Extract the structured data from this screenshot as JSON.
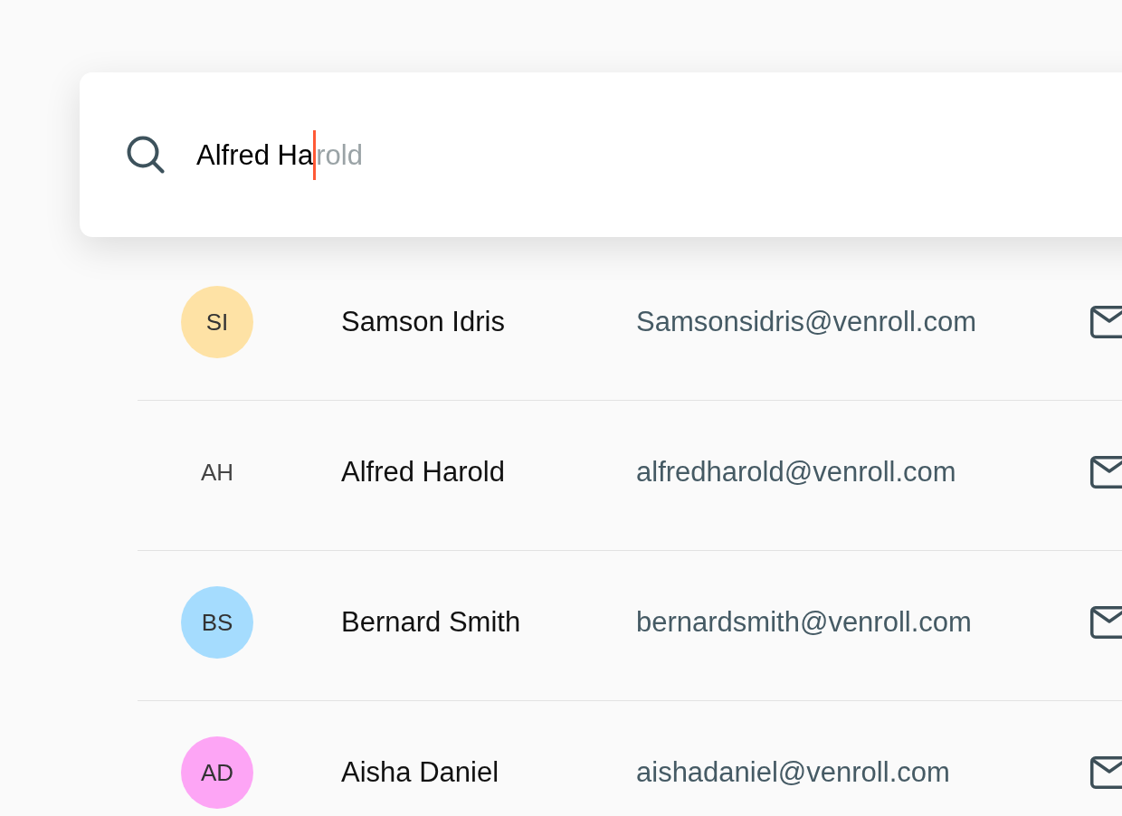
{
  "search": {
    "value": "Alfred Ha",
    "suggestion": "rold",
    "focused": true
  },
  "contacts": [
    {
      "initials": "SI",
      "color": "#fee2a5",
      "name": "Samson Idris",
      "email": "Samsonsidris@venroll.com"
    },
    {
      "initials": "AH",
      "name": "Alfred Harold",
      "email": "alfredharold@venroll.com"
    },
    {
      "initials": "BS",
      "color": "#a5dcfe",
      "name": "Bernard Smith",
      "email": "bernardsmith@venroll.com"
    },
    {
      "initials": "AD",
      "color": "#fda5f5",
      "name": "Aisha Daniel",
      "email": "aishadaniel@venroll.com"
    }
  ]
}
